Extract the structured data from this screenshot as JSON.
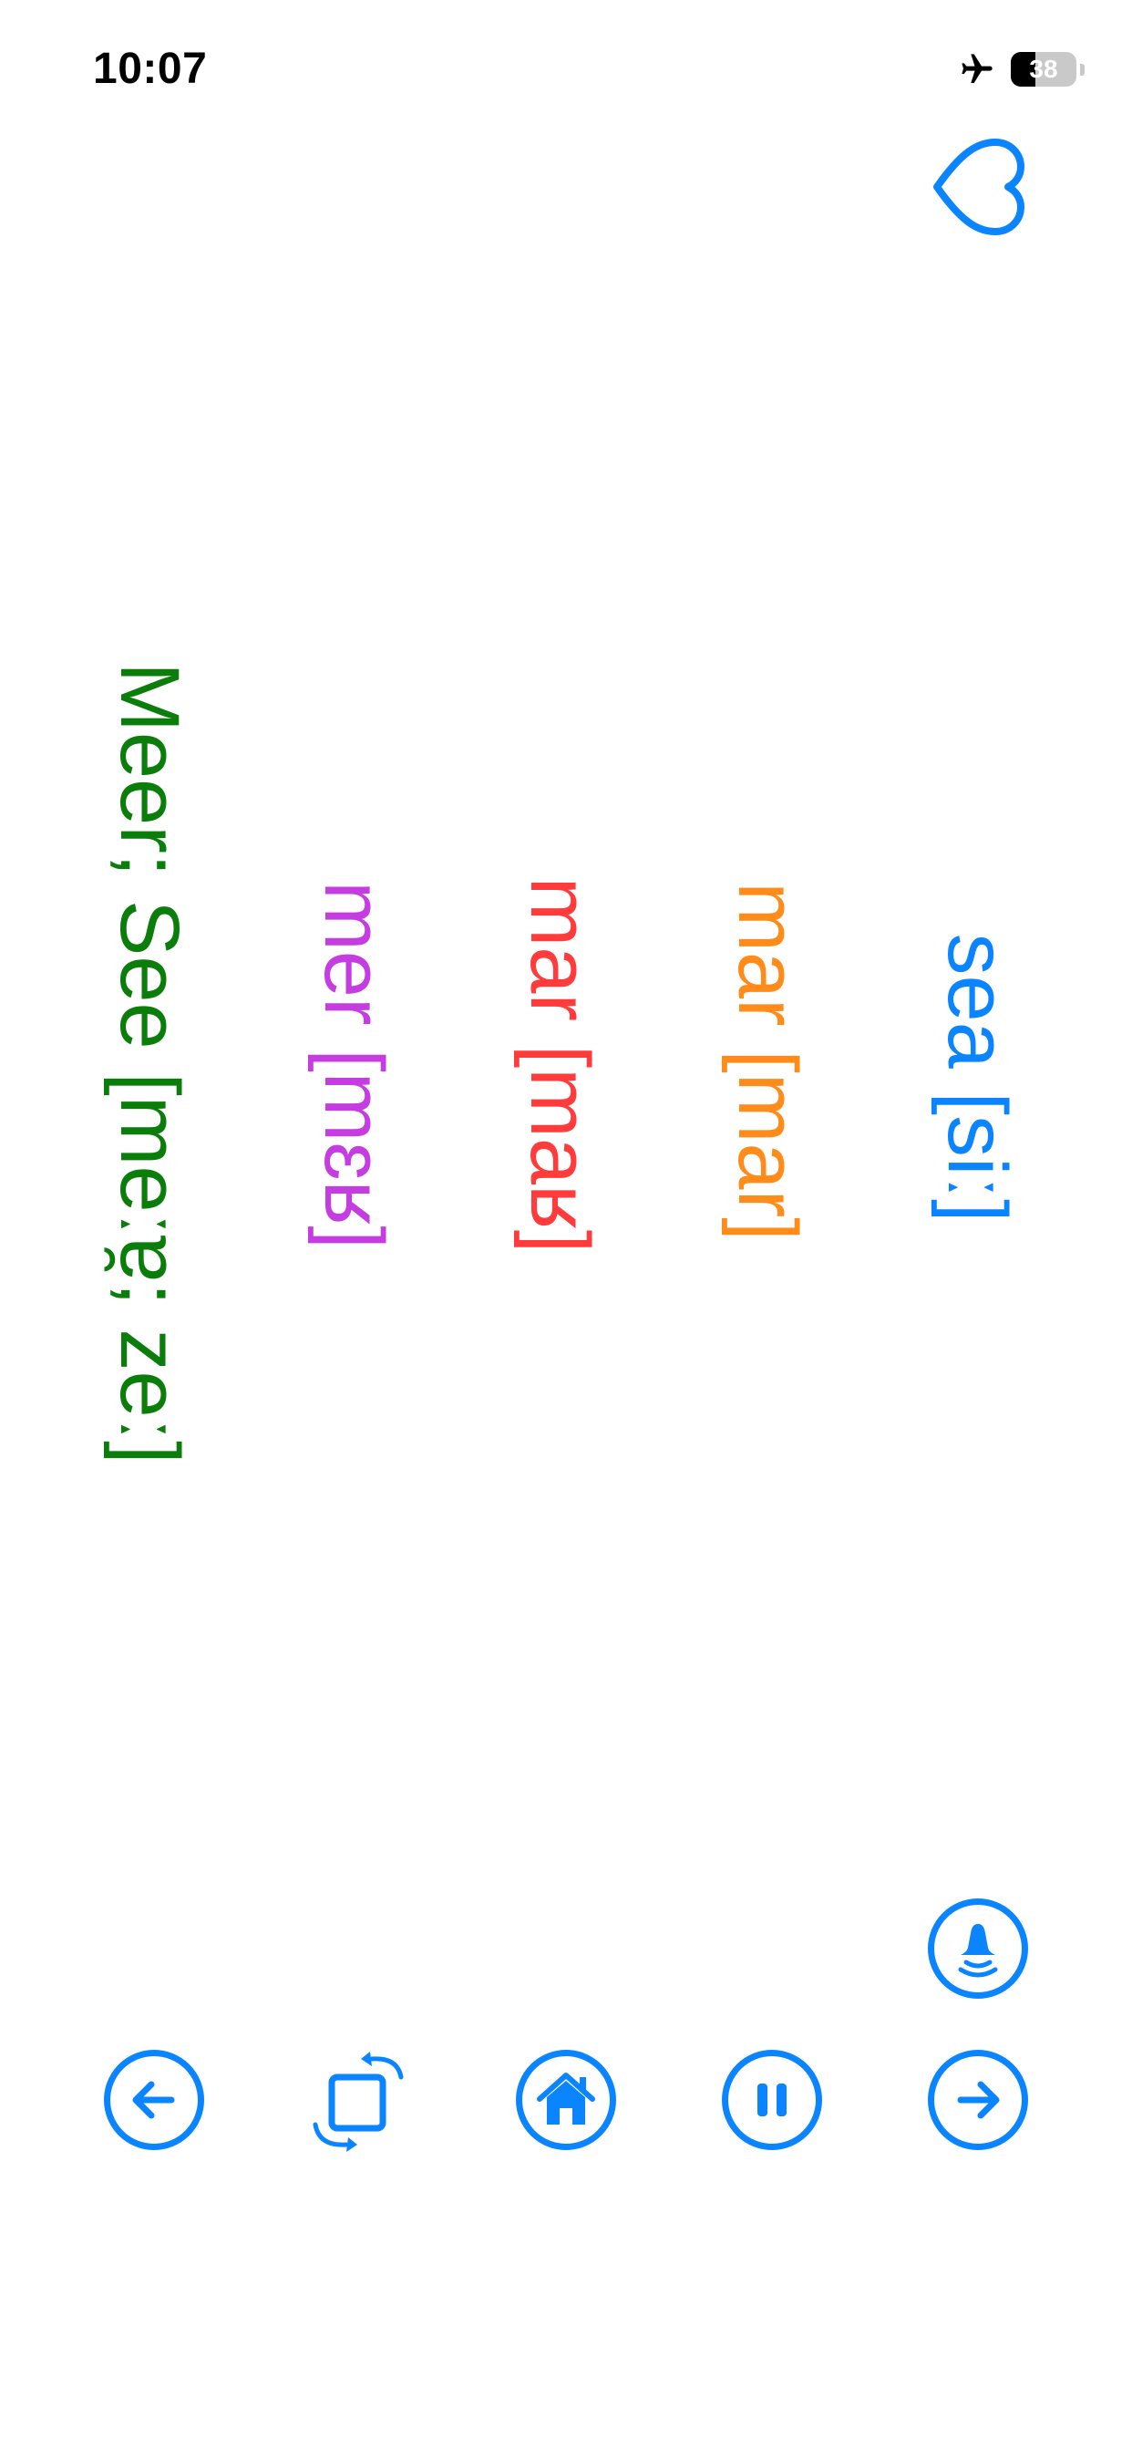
{
  "status_bar": {
    "time": "10:07",
    "battery_level": "38",
    "battery_percent": 38
  },
  "colors": {
    "accent": "#0a84ff",
    "english": "#0a84ff",
    "word_orange": "#ff8c1a",
    "word_red": "#ff3b3b",
    "word_purple": "#c53de0",
    "german": "#0a7d0a"
  },
  "words": [
    {
      "text": "sea [siː]",
      "color": "#0a84ff"
    },
    {
      "text": "mar [mar]",
      "color": "#ff8c1a"
    },
    {
      "text": "mar [maʁ]",
      "color": "#ff3b3b"
    },
    {
      "text": "mer [mɛʁ]",
      "color": "#c53de0"
    },
    {
      "text": "Meer; See [meːɐ̯; zeː]",
      "color": "#0a7d0a"
    }
  ],
  "icons": {
    "favorite": "heart-icon",
    "speak": "speaker-bell-icon",
    "previous": "arrow-left-icon",
    "rotate": "rotate-square-icon",
    "home": "home-icon",
    "pause": "pause-icon",
    "next": "arrow-right-icon"
  }
}
